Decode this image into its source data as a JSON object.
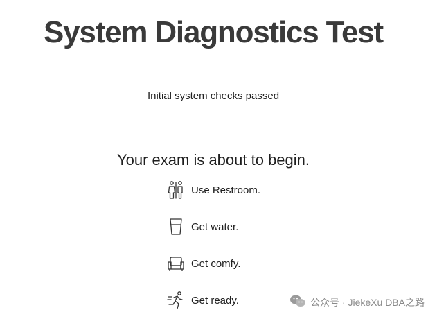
{
  "page": {
    "title": "System Diagnostics Test",
    "status_text": "Initial system checks passed",
    "headline": "Your exam is about to begin."
  },
  "steps": [
    {
      "label": "Use Restroom.",
      "icon": "restroom-icon"
    },
    {
      "label": "Get water.",
      "icon": "water-glass-icon"
    },
    {
      "label": "Get comfy.",
      "icon": "armchair-icon"
    },
    {
      "label": "Get ready.",
      "icon": "runner-icon"
    }
  ],
  "watermark": {
    "text": "公众号 · JiekeXu DBA之路",
    "icon": "wechat-icon"
  }
}
